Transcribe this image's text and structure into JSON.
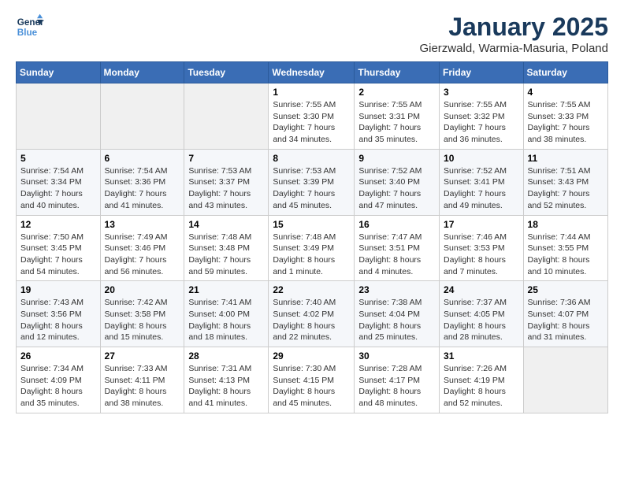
{
  "header": {
    "logo_line1": "General",
    "logo_line2": "Blue",
    "month": "January 2025",
    "location": "Gierzwald, Warmia-Masuria, Poland"
  },
  "weekdays": [
    "Sunday",
    "Monday",
    "Tuesday",
    "Wednesday",
    "Thursday",
    "Friday",
    "Saturday"
  ],
  "weeks": [
    [
      {
        "day": "",
        "detail": ""
      },
      {
        "day": "",
        "detail": ""
      },
      {
        "day": "",
        "detail": ""
      },
      {
        "day": "1",
        "detail": "Sunrise: 7:55 AM\nSunset: 3:30 PM\nDaylight: 7 hours and 34 minutes."
      },
      {
        "day": "2",
        "detail": "Sunrise: 7:55 AM\nSunset: 3:31 PM\nDaylight: 7 hours and 35 minutes."
      },
      {
        "day": "3",
        "detail": "Sunrise: 7:55 AM\nSunset: 3:32 PM\nDaylight: 7 hours and 36 minutes."
      },
      {
        "day": "4",
        "detail": "Sunrise: 7:55 AM\nSunset: 3:33 PM\nDaylight: 7 hours and 38 minutes."
      }
    ],
    [
      {
        "day": "5",
        "detail": "Sunrise: 7:54 AM\nSunset: 3:34 PM\nDaylight: 7 hours and 40 minutes."
      },
      {
        "day": "6",
        "detail": "Sunrise: 7:54 AM\nSunset: 3:36 PM\nDaylight: 7 hours and 41 minutes."
      },
      {
        "day": "7",
        "detail": "Sunrise: 7:53 AM\nSunset: 3:37 PM\nDaylight: 7 hours and 43 minutes."
      },
      {
        "day": "8",
        "detail": "Sunrise: 7:53 AM\nSunset: 3:39 PM\nDaylight: 7 hours and 45 minutes."
      },
      {
        "day": "9",
        "detail": "Sunrise: 7:52 AM\nSunset: 3:40 PM\nDaylight: 7 hours and 47 minutes."
      },
      {
        "day": "10",
        "detail": "Sunrise: 7:52 AM\nSunset: 3:41 PM\nDaylight: 7 hours and 49 minutes."
      },
      {
        "day": "11",
        "detail": "Sunrise: 7:51 AM\nSunset: 3:43 PM\nDaylight: 7 hours and 52 minutes."
      }
    ],
    [
      {
        "day": "12",
        "detail": "Sunrise: 7:50 AM\nSunset: 3:45 PM\nDaylight: 7 hours and 54 minutes."
      },
      {
        "day": "13",
        "detail": "Sunrise: 7:49 AM\nSunset: 3:46 PM\nDaylight: 7 hours and 56 minutes."
      },
      {
        "day": "14",
        "detail": "Sunrise: 7:48 AM\nSunset: 3:48 PM\nDaylight: 7 hours and 59 minutes."
      },
      {
        "day": "15",
        "detail": "Sunrise: 7:48 AM\nSunset: 3:49 PM\nDaylight: 8 hours and 1 minute."
      },
      {
        "day": "16",
        "detail": "Sunrise: 7:47 AM\nSunset: 3:51 PM\nDaylight: 8 hours and 4 minutes."
      },
      {
        "day": "17",
        "detail": "Sunrise: 7:46 AM\nSunset: 3:53 PM\nDaylight: 8 hours and 7 minutes."
      },
      {
        "day": "18",
        "detail": "Sunrise: 7:44 AM\nSunset: 3:55 PM\nDaylight: 8 hours and 10 minutes."
      }
    ],
    [
      {
        "day": "19",
        "detail": "Sunrise: 7:43 AM\nSunset: 3:56 PM\nDaylight: 8 hours and 12 minutes."
      },
      {
        "day": "20",
        "detail": "Sunrise: 7:42 AM\nSunset: 3:58 PM\nDaylight: 8 hours and 15 minutes."
      },
      {
        "day": "21",
        "detail": "Sunrise: 7:41 AM\nSunset: 4:00 PM\nDaylight: 8 hours and 18 minutes."
      },
      {
        "day": "22",
        "detail": "Sunrise: 7:40 AM\nSunset: 4:02 PM\nDaylight: 8 hours and 22 minutes."
      },
      {
        "day": "23",
        "detail": "Sunrise: 7:38 AM\nSunset: 4:04 PM\nDaylight: 8 hours and 25 minutes."
      },
      {
        "day": "24",
        "detail": "Sunrise: 7:37 AM\nSunset: 4:05 PM\nDaylight: 8 hours and 28 minutes."
      },
      {
        "day": "25",
        "detail": "Sunrise: 7:36 AM\nSunset: 4:07 PM\nDaylight: 8 hours and 31 minutes."
      }
    ],
    [
      {
        "day": "26",
        "detail": "Sunrise: 7:34 AM\nSunset: 4:09 PM\nDaylight: 8 hours and 35 minutes."
      },
      {
        "day": "27",
        "detail": "Sunrise: 7:33 AM\nSunset: 4:11 PM\nDaylight: 8 hours and 38 minutes."
      },
      {
        "day": "28",
        "detail": "Sunrise: 7:31 AM\nSunset: 4:13 PM\nDaylight: 8 hours and 41 minutes."
      },
      {
        "day": "29",
        "detail": "Sunrise: 7:30 AM\nSunset: 4:15 PM\nDaylight: 8 hours and 45 minutes."
      },
      {
        "day": "30",
        "detail": "Sunrise: 7:28 AM\nSunset: 4:17 PM\nDaylight: 8 hours and 48 minutes."
      },
      {
        "day": "31",
        "detail": "Sunrise: 7:26 AM\nSunset: 4:19 PM\nDaylight: 8 hours and 52 minutes."
      },
      {
        "day": "",
        "detail": ""
      }
    ]
  ]
}
